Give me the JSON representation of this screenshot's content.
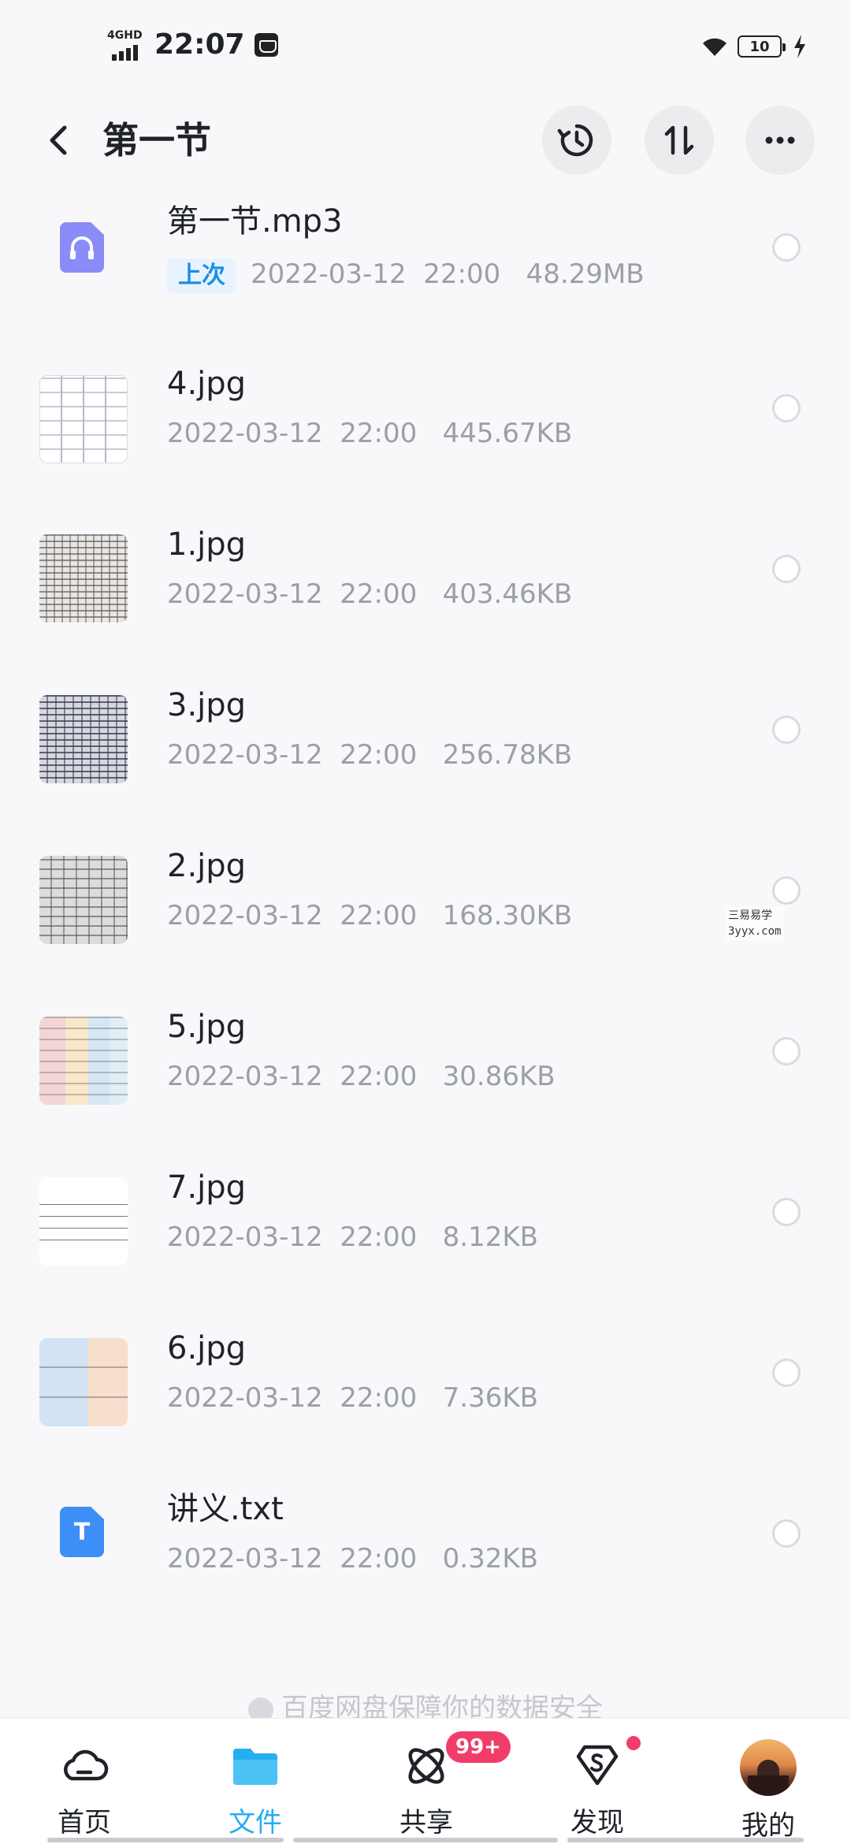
{
  "status_bar": {
    "network": "4GHD",
    "time": "22:07",
    "battery": "10"
  },
  "header": {
    "title": "第一节"
  },
  "files": [
    {
      "name": "第一节.mp3",
      "tag": "上次",
      "date": "2022-03-12",
      "time": "22:00",
      "size": "48.29MB",
      "icon": "audio-file-icon"
    },
    {
      "name": "4.jpg",
      "date": "2022-03-12",
      "time": "22:00",
      "size": "445.67KB",
      "icon": "image-thumbnail"
    },
    {
      "name": "1.jpg",
      "date": "2022-03-12",
      "time": "22:00",
      "size": "403.46KB",
      "icon": "image-thumbnail"
    },
    {
      "name": "3.jpg",
      "date": "2022-03-12",
      "time": "22:00",
      "size": "256.78KB",
      "icon": "image-thumbnail"
    },
    {
      "name": "2.jpg",
      "date": "2022-03-12",
      "time": "22:00",
      "size": "168.30KB",
      "icon": "image-thumbnail"
    },
    {
      "name": "5.jpg",
      "date": "2022-03-12",
      "time": "22:00",
      "size": "30.86KB",
      "icon": "image-thumbnail"
    },
    {
      "name": "7.jpg",
      "date": "2022-03-12",
      "time": "22:00",
      "size": "8.12KB",
      "icon": "image-thumbnail"
    },
    {
      "name": "6.jpg",
      "date": "2022-03-12",
      "time": "22:00",
      "size": "7.36KB",
      "icon": "image-thumbnail"
    },
    {
      "name": "讲义.txt",
      "date": "2022-03-12",
      "time": "22:00",
      "size": "0.32KB",
      "icon": "text-file-icon"
    }
  ],
  "icons": {
    "txt_letter": "T"
  },
  "watermark": {
    "line1": "三易易学",
    "line2": "3yyx.com"
  },
  "footer_note": "百度网盘保障你的数据安全",
  "bottom_nav": {
    "items": [
      {
        "label": "首页",
        "icon": "home-cloud-icon"
      },
      {
        "label": "文件",
        "icon": "folder-icon",
        "active": true
      },
      {
        "label": "共享",
        "icon": "share-atom-icon"
      },
      {
        "label": "发现",
        "icon": "discover-icon"
      },
      {
        "label": "我的",
        "icon": "avatar"
      }
    ],
    "share_badge": "99+"
  },
  "colors": {
    "accent": "#25aef0",
    "badge": "#f23c6a",
    "tag_bg": "#e8f3ff",
    "tag_text": "#1a8fe3"
  }
}
